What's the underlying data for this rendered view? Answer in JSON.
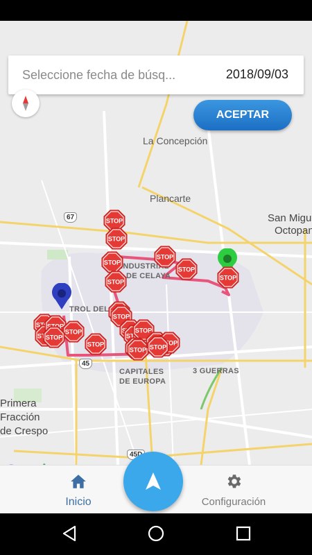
{
  "search": {
    "placeholder": "Seleccione fecha de búsq...",
    "date": "2018/09/03"
  },
  "accept_button": {
    "label": "ACEPTAR"
  },
  "map": {
    "places": {
      "la_concepcion": "La Concepción",
      "plancarte": "Plancarte",
      "san_miguel": "San Migu",
      "octopan": "Octopan",
      "industrial": "INDUSTRIAL",
      "de_celaya": "DE CELAYA",
      "del_parque": "TROL DEL PA",
      "tres_guerras": "3 GUERRAS",
      "capitales": "CAPITALES",
      "de_europa": "DE EUROPA",
      "primera": "Primera",
      "fraccion": "Fracción",
      "de_crespo": "de Crespo"
    },
    "shields": {
      "r67": "67",
      "r45": "45",
      "r45d": "45D"
    },
    "stop_label": "STOP",
    "route_color": "#e8557a",
    "start_marker_color": "#2e3fbf",
    "end_marker_color": "#2ecc40",
    "logo": "Google"
  },
  "bottom_nav": {
    "home_label": "Inicio",
    "settings_label": "Configuración"
  },
  "colors": {
    "accent": "#3aa8ea",
    "active_nav": "#3d6fa6",
    "stop_red": "#e53935"
  }
}
